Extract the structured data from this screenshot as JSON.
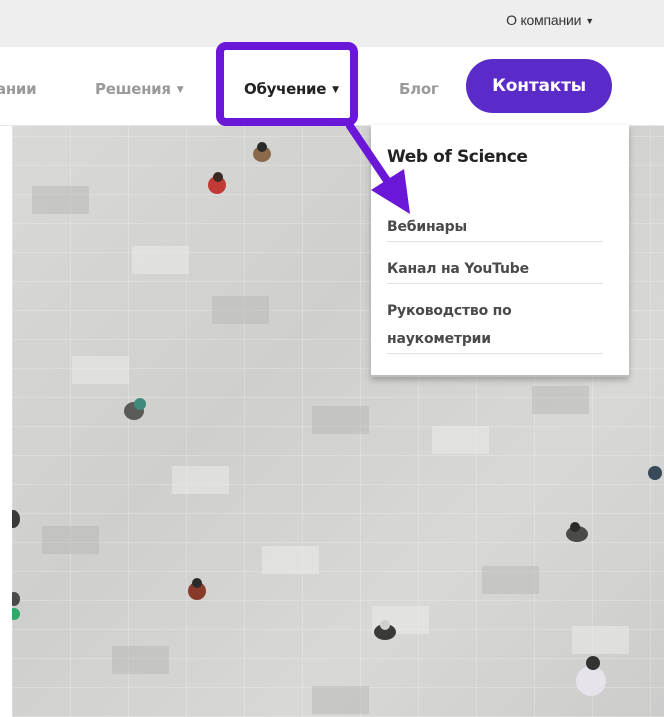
{
  "topbar": {
    "about_label": "О компании"
  },
  "nav": {
    "clipped_label": "ании",
    "solutions_label": "Решения",
    "learning_label": "Обучение",
    "blog_label": "Блог",
    "contacts_label": "Контакты"
  },
  "dropdown": {
    "title": "Web of Science",
    "items": [
      {
        "label": "Вебинары"
      },
      {
        "label": "Канал на YouTube"
      },
      {
        "label": "Руководство по наукометрии"
      }
    ]
  },
  "colors": {
    "accent": "#5a2bc9",
    "highlight": "#6a17d8",
    "topbar_bg": "#eeeeee"
  }
}
